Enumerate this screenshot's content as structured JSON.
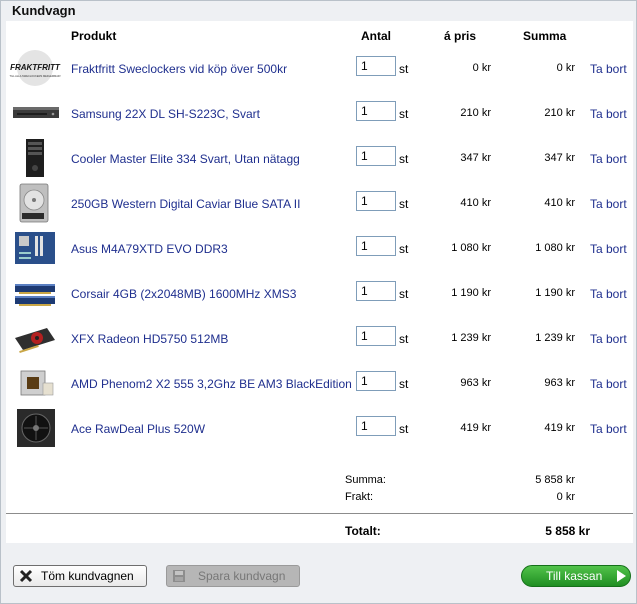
{
  "window": {
    "title": "Kundvagn"
  },
  "columns": {
    "product": "Produkt",
    "quantity": "Antal",
    "unit_price": "á pris",
    "total": "Summa"
  },
  "colors": {
    "link": "#1f2f8e",
    "checkout_green": "#2a9a2c",
    "panel_bg": "#eef0f3"
  },
  "items": [
    {
      "icon": "fraktfritt-logo",
      "name": "Fraktfritt Sweclockers vid köp över 500kr",
      "qty": "1",
      "unit": "st",
      "price": "0 kr",
      "sum": "0 kr",
      "remove": "Ta bort"
    },
    {
      "icon": "dvd-drive",
      "name": "Samsung 22X DL SH-S223C, Svart",
      "qty": "1",
      "unit": "st",
      "price": "210 kr",
      "sum": "210 kr",
      "remove": "Ta bort"
    },
    {
      "icon": "pc-case",
      "name": "Cooler Master Elite 334 Svart, Utan nätagg",
      "qty": "1",
      "unit": "st",
      "price": "347 kr",
      "sum": "347 kr",
      "remove": "Ta bort"
    },
    {
      "icon": "hard-drive",
      "name": "250GB Western Digital Caviar Blue SATA II",
      "qty": "1",
      "unit": "st",
      "price": "410 kr",
      "sum": "410 kr",
      "remove": "Ta bort"
    },
    {
      "icon": "motherboard",
      "name": "Asus M4A79XTD EVO DDR3",
      "qty": "1",
      "unit": "st",
      "price": "1 080 kr",
      "sum": "1 080 kr",
      "remove": "Ta bort"
    },
    {
      "icon": "ram-modules",
      "name": "Corsair 4GB (2x2048MB) 1600MHz XMS3",
      "qty": "1",
      "unit": "st",
      "price": "1 190 kr",
      "sum": "1 190 kr",
      "remove": "Ta bort"
    },
    {
      "icon": "graphics-card",
      "name": "XFX Radeon HD5750 512MB",
      "qty": "1",
      "unit": "st",
      "price": "1 239 kr",
      "sum": "1 239 kr",
      "remove": "Ta bort"
    },
    {
      "icon": "cpu",
      "name": "AMD Phenom2 X2 555 3,2Ghz BE AM3 BlackEdition",
      "qty": "1",
      "unit": "st",
      "price": "963 kr",
      "sum": "963 kr",
      "remove": "Ta bort"
    },
    {
      "icon": "power-supply",
      "name": "Ace RawDeal Plus 520W",
      "qty": "1",
      "unit": "st",
      "price": "419 kr",
      "sum": "419 kr",
      "remove": "Ta bort"
    }
  ],
  "totals": {
    "sum_label": "Summa:",
    "sum_value": "5 858 kr",
    "freight_label": "Frakt:",
    "freight_value": "0 kr",
    "total_label": "Totalt:",
    "total_value": "5 858 kr"
  },
  "fraktfritt_logo": {
    "line1": "FRAKTFRITT",
    "line2": "TILL ALLA SWECLOCKERS MEDLEMMAR!"
  },
  "buttons": {
    "empty_cart": "Töm kundvagnen",
    "save_cart": "Spara kundvagn",
    "checkout": "Till kassan"
  }
}
